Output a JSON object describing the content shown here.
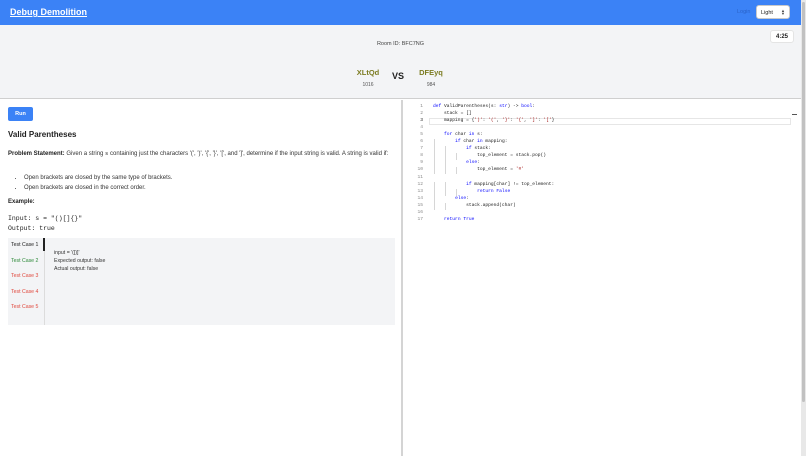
{
  "topbar": {
    "brand": "Debug Demolition",
    "login": "Login",
    "theme": "Light"
  },
  "match": {
    "room_id": "Room ID: BFC7NG",
    "timer": "4:25",
    "vs": "VS",
    "player1": {
      "name": "XLtQd",
      "score": "1016"
    },
    "player2": {
      "name": "DFEyq",
      "score": "984"
    }
  },
  "problem": {
    "run_label": "Run",
    "title": "Valid Parentheses",
    "statement_label": "Problem Statement:",
    "statement_a": " Given a string ",
    "statement_var": "s",
    "statement_b": " containing just the characters '(', ')', '{', '}', '[', and ']', determine if the input string is valid. A string is valid if:",
    "bullets": [
      "Open brackets are closed by the same type of brackets.",
      "Open brackets are closed in the correct order."
    ],
    "example_label": "Example:",
    "example_code": "Input: s = \"()[]{}\"\nOutput: true"
  },
  "tests": {
    "tabs": [
      {
        "label": "Test Case 1",
        "status": "active"
      },
      {
        "label": "Test Case 2",
        "status": "pass"
      },
      {
        "label": "Test Case 3",
        "status": "fail"
      },
      {
        "label": "Test Case 4",
        "status": "fail"
      },
      {
        "label": "Test Case 5",
        "status": "fail"
      }
    ],
    "detail": "input = '([)]'\nExpected output: false\nActual output: false"
  },
  "editor": {
    "current_line": 3,
    "lines": [
      "def ValidParentheses(s: str) -> bool:",
      "    stack = []",
      "    mapping = {')': '(', '}': '{', ']': '['}",
      "",
      "    for char in s:",
      "        if char in mapping:",
      "            if stack:",
      "                top_element = stack.pop()",
      "            else:",
      "                top_element = '#'",
      "",
      "            if mapping[char] != top_element:",
      "                return False",
      "        else:",
      "            stack.append(char)",
      "",
      "    return True"
    ]
  },
  "colors": {
    "accent": "#3b82f6",
    "player_name": "#7c7c22",
    "pass": "#2f8a3a",
    "fail": "#e04a3f",
    "keyword": "#0000ff",
    "string": "#a31515"
  }
}
